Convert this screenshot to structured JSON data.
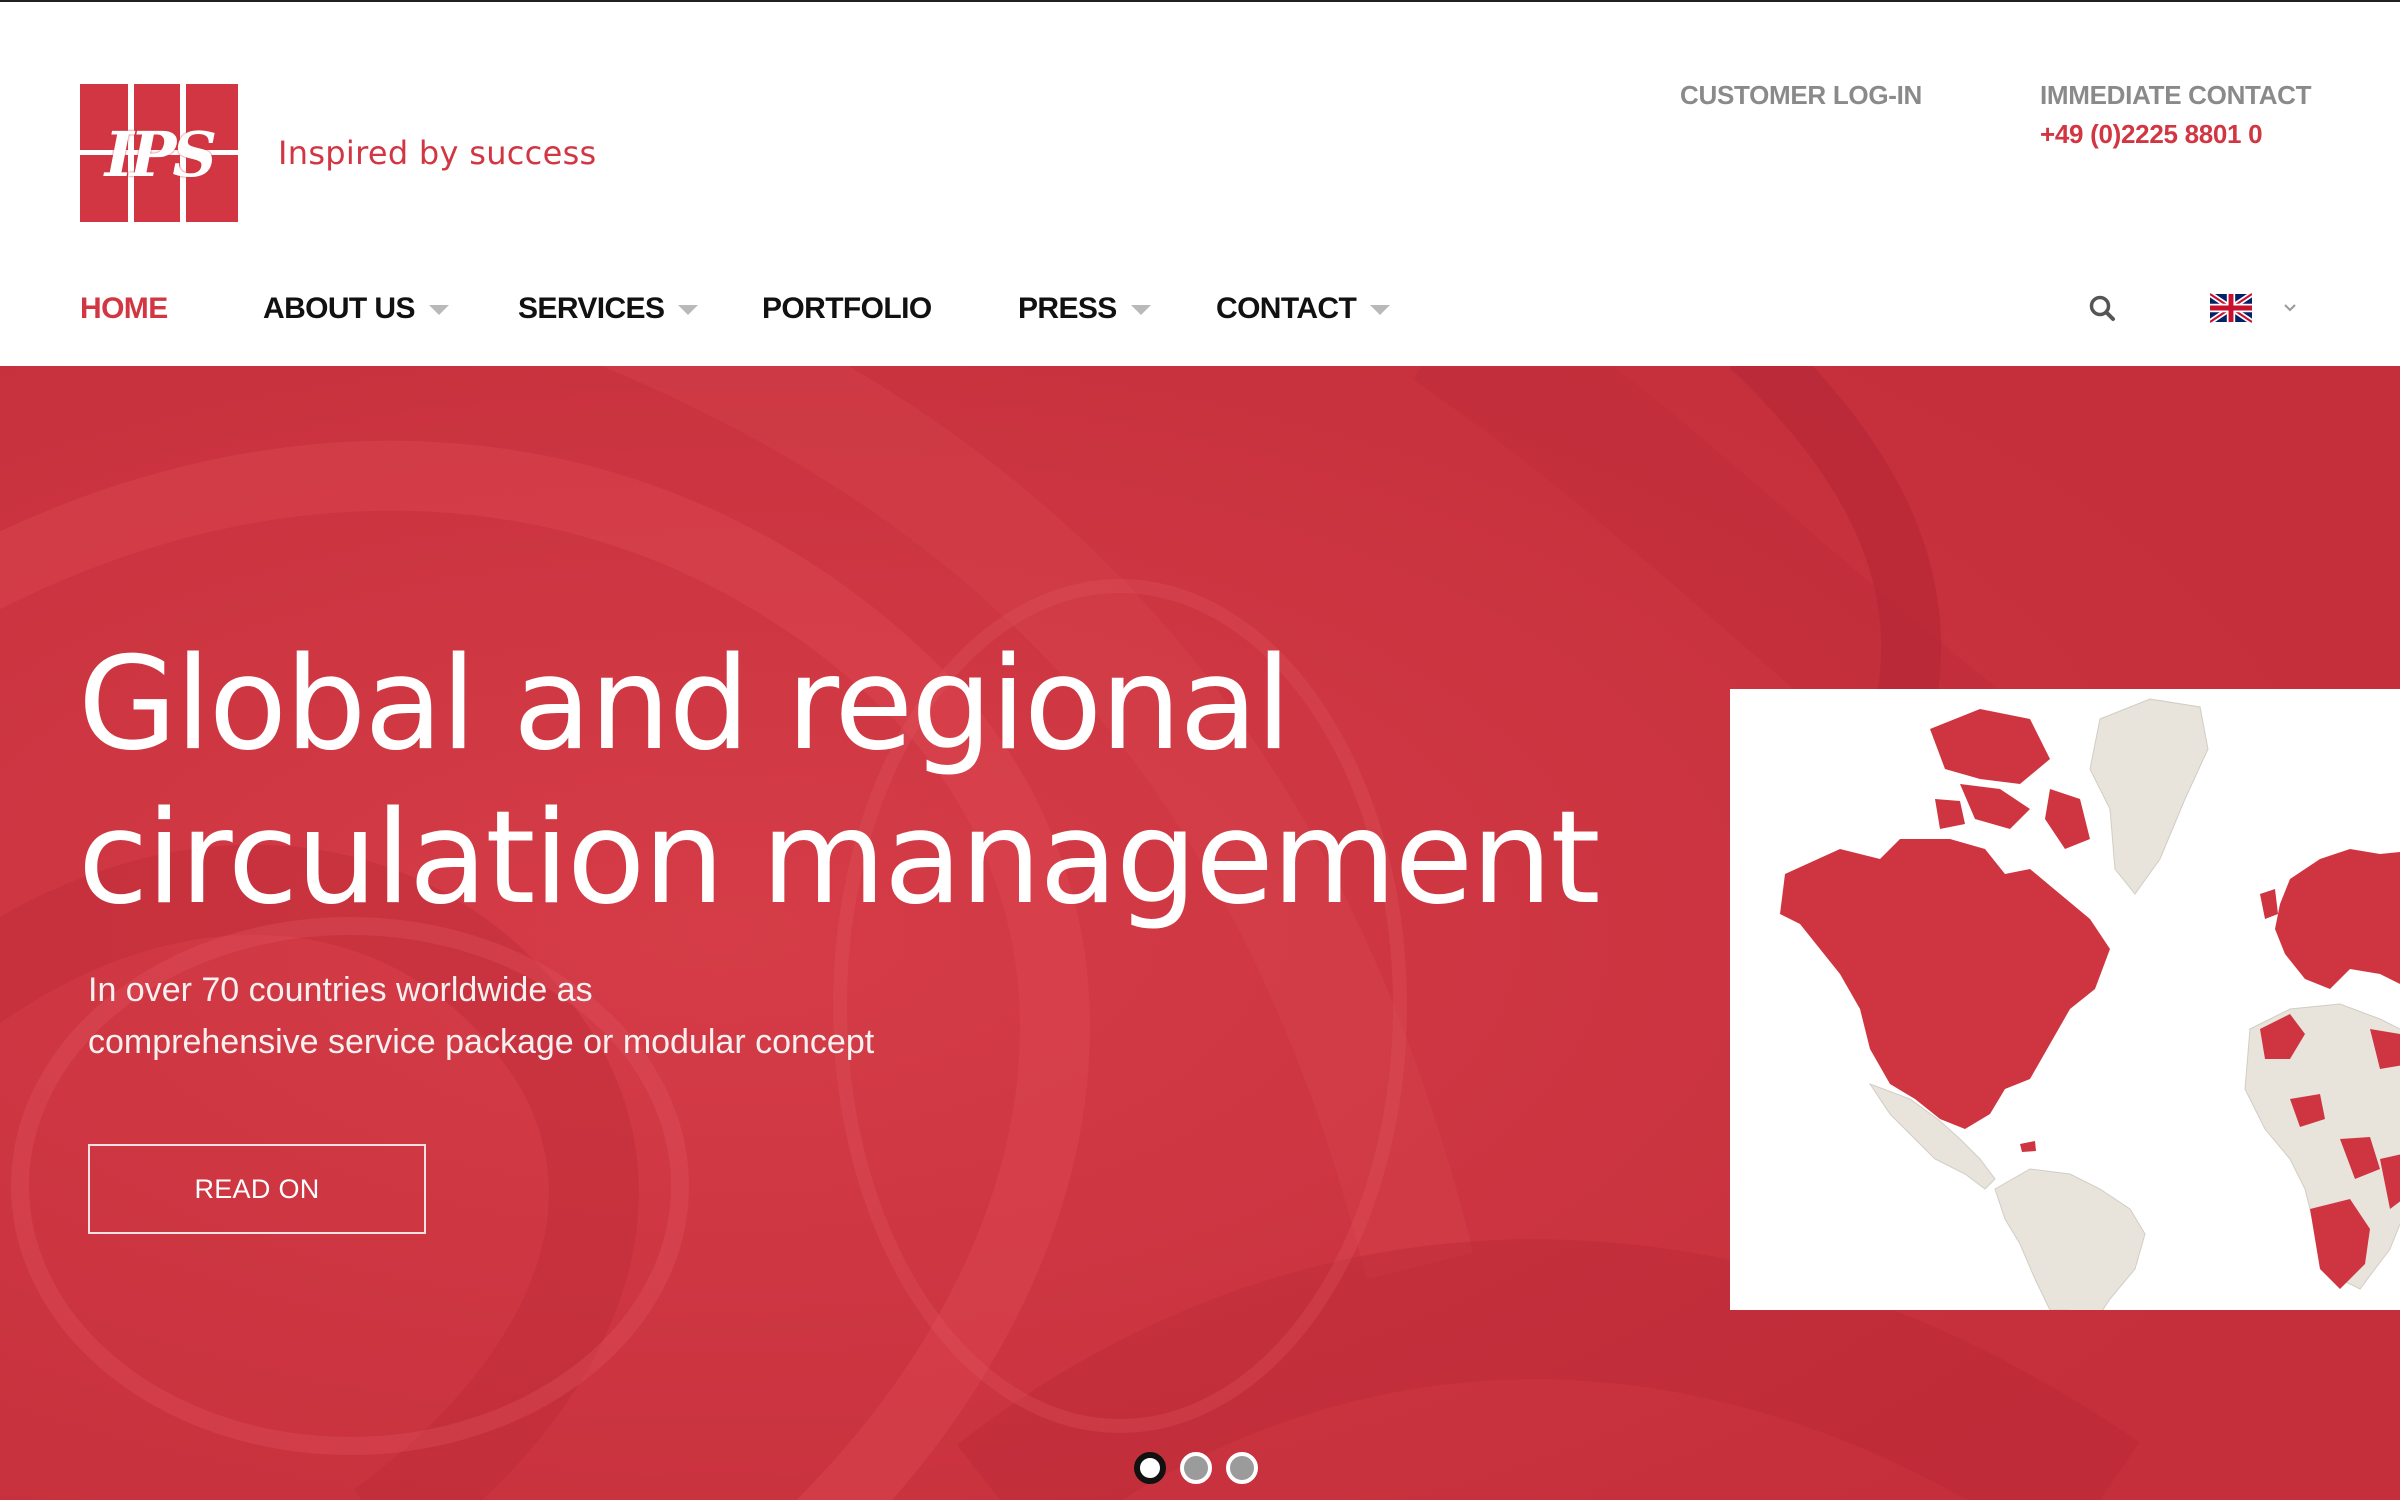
{
  "brand": {
    "logo_monogram": "IPS",
    "tagline": "Inspired by success",
    "accent_color": "#d13642"
  },
  "utility": {
    "login_label": "CUSTOMER LOG-IN",
    "contact_label": "IMMEDIATE CONTACT",
    "contact_phone": "+49 (0)2225 8801 0"
  },
  "nav": {
    "items": [
      {
        "label": "HOME",
        "active": true,
        "has_dropdown": false
      },
      {
        "label": "ABOUT US",
        "active": false,
        "has_dropdown": true
      },
      {
        "label": "SERVICES",
        "active": false,
        "has_dropdown": true
      },
      {
        "label": "PORTFOLIO",
        "active": false,
        "has_dropdown": false
      },
      {
        "label": "PRESS",
        "active": false,
        "has_dropdown": true
      },
      {
        "label": "CONTACT",
        "active": false,
        "has_dropdown": true
      }
    ],
    "search_icon": "search-icon",
    "language_flag": "uk-flag-icon"
  },
  "hero": {
    "title_line1": "Global and regional",
    "title_line2": "circulation management",
    "subtitle_line1": "In over 70 countries worldwide as",
    "subtitle_line2": "comprehensive service package or modular concept",
    "cta_label": "READ ON",
    "map_image": "world-map-coverage",
    "slides": {
      "count": 3,
      "active_index": 0
    }
  }
}
